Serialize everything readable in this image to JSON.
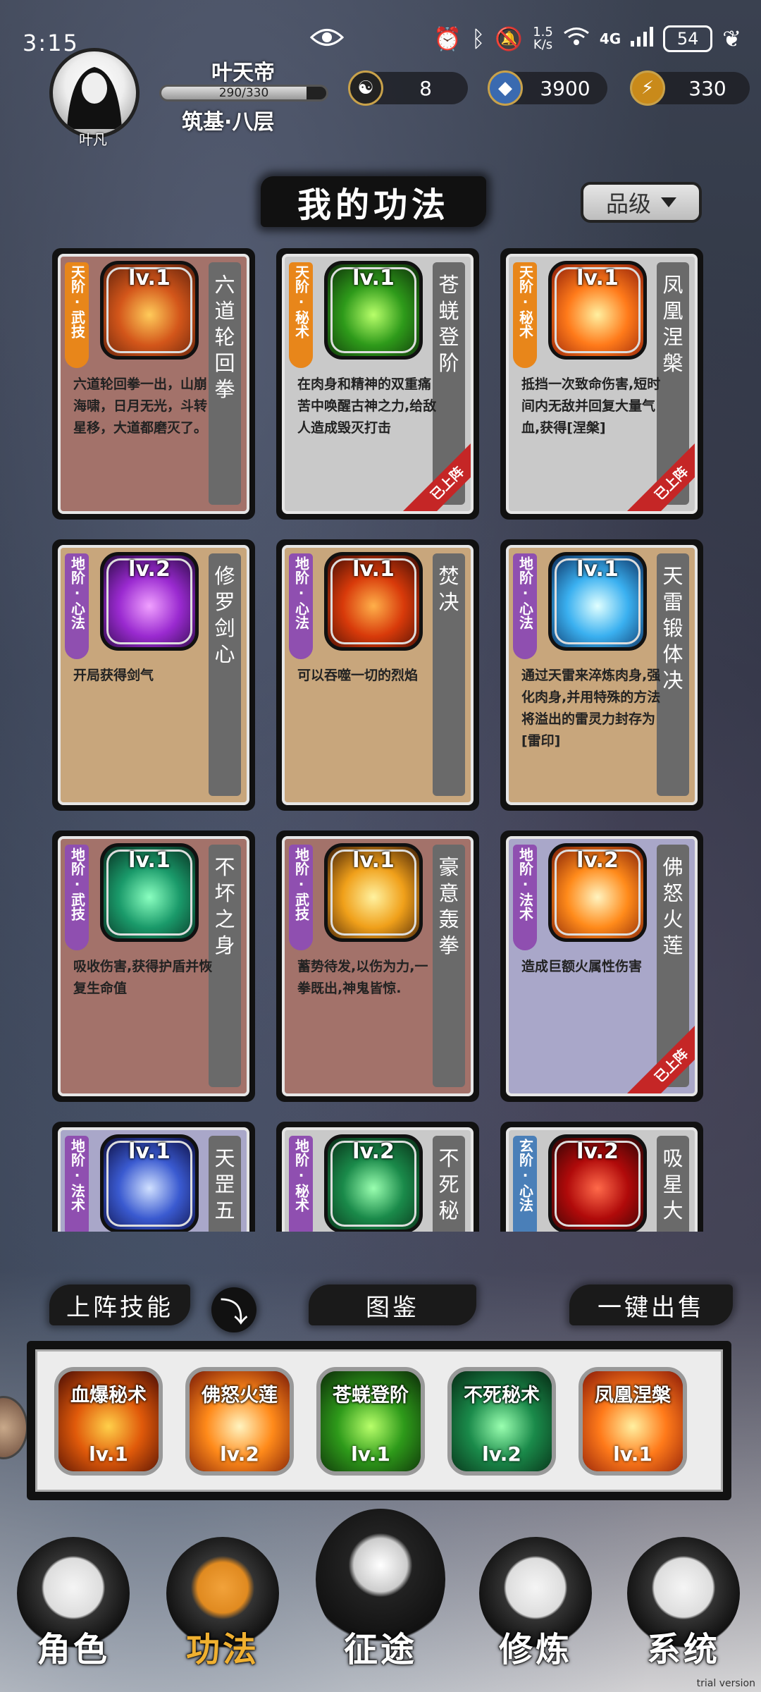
{
  "status_bar": {
    "time": "3:15",
    "net_speed_value": "1.5",
    "net_speed_unit": "K/s",
    "network": "4G",
    "battery": "54"
  },
  "player": {
    "avatar_name": "叶凡",
    "name": "叶天帝",
    "exp": "290/330",
    "exp_fraction": 0.879,
    "realm": "筑基·八层"
  },
  "resources": [
    {
      "icon": "yin-yang-icon",
      "value": "8"
    },
    {
      "icon": "spirit-stone-icon",
      "value": "3900"
    },
    {
      "icon": "lightning-icon",
      "value": "330"
    }
  ],
  "title": "我的功法",
  "sort_label": "品级",
  "cards": [
    {
      "tag": "天阶·武技",
      "tag_color": "orange",
      "bg": "brown",
      "level": "lv.1",
      "name": "六道轮回拳",
      "desc": "六道轮回拳一出，山崩海啸，日月无光，斗转星移，大道都磨灭了。",
      "equipped": false,
      "art": [
        "#ffcb5a",
        "#d3561a",
        "#5a1e0a"
      ]
    },
    {
      "tag": "天阶·秘术",
      "tag_color": "orange",
      "bg": "grey",
      "level": "lv.1",
      "name": "苍蜣登阶",
      "desc": "在肉身和精神的双重痛苦中唤醒古神之力,给敌人造成毁灭打击",
      "equipped": true,
      "art": [
        "#b8ff6a",
        "#2e9a1a",
        "#0c2a08"
      ]
    },
    {
      "tag": "天阶·秘术",
      "tag_color": "orange",
      "bg": "grey",
      "level": "lv.1",
      "name": "凤凰涅槃",
      "desc": "抵挡一次致命伤害,短时间内无敌并回复大量气血,获得[涅槃]",
      "equipped": true,
      "art": [
        "#fff0a0",
        "#ff7a1a",
        "#8a1a08"
      ]
    },
    {
      "tag": "地阶·心法",
      "tag_color": "purple",
      "bg": "tan",
      "level": "lv.2",
      "name": "修罗剑心",
      "desc": "开局获得剑气",
      "equipped": false,
      "art": [
        "#f0a0ff",
        "#9a2ad0",
        "#22083a"
      ]
    },
    {
      "tag": "地阶·心法",
      "tag_color": "purple",
      "bg": "tan",
      "level": "lv.1",
      "name": "焚决",
      "desc": "可以吞噬一切的烈焰",
      "equipped": false,
      "art": [
        "#ffb04a",
        "#d83a0a",
        "#3a0a04"
      ]
    },
    {
      "tag": "地阶·心法",
      "tag_color": "purple",
      "bg": "tan",
      "level": "lv.1",
      "name": "天雷锻体决",
      "desc": "通过天雷来淬炼肉身,强化肉身,并用特殊的方法将溢出的雷灵力封存为[雷印]",
      "equipped": false,
      "art": [
        "#e0ffff",
        "#3ab0f0",
        "#0a2a5a"
      ]
    },
    {
      "tag": "地阶·武技",
      "tag_color": "purple",
      "bg": "brown",
      "level": "lv.1",
      "name": "不坏之身",
      "desc": "吸收伤害,获得护盾并恢复生命值",
      "equipped": false,
      "art": [
        "#8affc0",
        "#1a9a6a",
        "#06281c"
      ]
    },
    {
      "tag": "地阶·武技",
      "tag_color": "purple",
      "bg": "brown",
      "level": "lv.1",
      "name": "豪意轰拳",
      "desc": "蓄势待发,以伤为力,一拳既出,神鬼皆惊.",
      "equipped": false,
      "art": [
        "#fff2a0",
        "#f0a01a",
        "#3a1a06"
      ]
    },
    {
      "tag": "地阶·法术",
      "tag_color": "purple",
      "bg": "lav",
      "level": "lv.2",
      "name": "佛怒火莲",
      "desc": "造成巨额火属性伤害",
      "equipped": true,
      "art": [
        "#fff4c0",
        "#ff8a1a",
        "#7a1a06"
      ]
    },
    {
      "tag": "地阶·法术",
      "tag_color": "purple",
      "bg": "lav",
      "level": "lv.1",
      "name": "天罡五",
      "desc": "",
      "equipped": false,
      "art": [
        "#d0e0ff",
        "#3a5ad0",
        "#0a0a3a"
      ]
    },
    {
      "tag": "地阶·秘术",
      "tag_color": "purple",
      "bg": "grey",
      "level": "lv.2",
      "name": "不死秘",
      "desc": "",
      "equipped": false,
      "art": [
        "#9affb0",
        "#1a8a4a",
        "#062a14"
      ]
    },
    {
      "tag": "玄阶·心法",
      "tag_color": "blue",
      "bg": "grey",
      "level": "lv.2",
      "name": "吸星大",
      "desc": "",
      "equipped": false,
      "art": [
        "#ff6a4a",
        "#b00a0a",
        "#2a0404"
      ]
    }
  ],
  "equipped_label": "已上阵",
  "bottom_buttons": {
    "deploy": "上阵技能",
    "arrow": "⤵",
    "codex": "图鉴",
    "sell": "一键出售"
  },
  "deck": [
    {
      "name": "血爆秘术",
      "level": "lv.1",
      "art": [
        "#ffd04a",
        "#e05a0a",
        "#4a0c04"
      ]
    },
    {
      "name": "佛怒火莲",
      "level": "lv.2",
      "art": [
        "#fff4c0",
        "#ff8a1a",
        "#7a1a06"
      ]
    },
    {
      "name": "苍蜣登阶",
      "level": "lv.1",
      "art": [
        "#b8ff6a",
        "#2e9a1a",
        "#0c2a08"
      ]
    },
    {
      "name": "不死秘术",
      "level": "lv.2",
      "art": [
        "#9affb0",
        "#1a8a4a",
        "#062a14"
      ]
    },
    {
      "name": "凤凰涅槃",
      "level": "lv.1",
      "art": [
        "#fff0a0",
        "#ff7a1a",
        "#8a1a08"
      ]
    }
  ],
  "nav": [
    {
      "label": "角色",
      "icon": "hooded-character-icon",
      "active": false
    },
    {
      "label": "功法",
      "icon": "scroll-book-icon",
      "active": true
    },
    {
      "label": "征途",
      "icon": "sword-emblem-icon",
      "active": false
    },
    {
      "label": "修炼",
      "icon": "meditating-figure-icon",
      "active": false
    },
    {
      "label": "系统",
      "icon": "panda-girl-icon",
      "active": false
    }
  ],
  "watermark": "trial version"
}
